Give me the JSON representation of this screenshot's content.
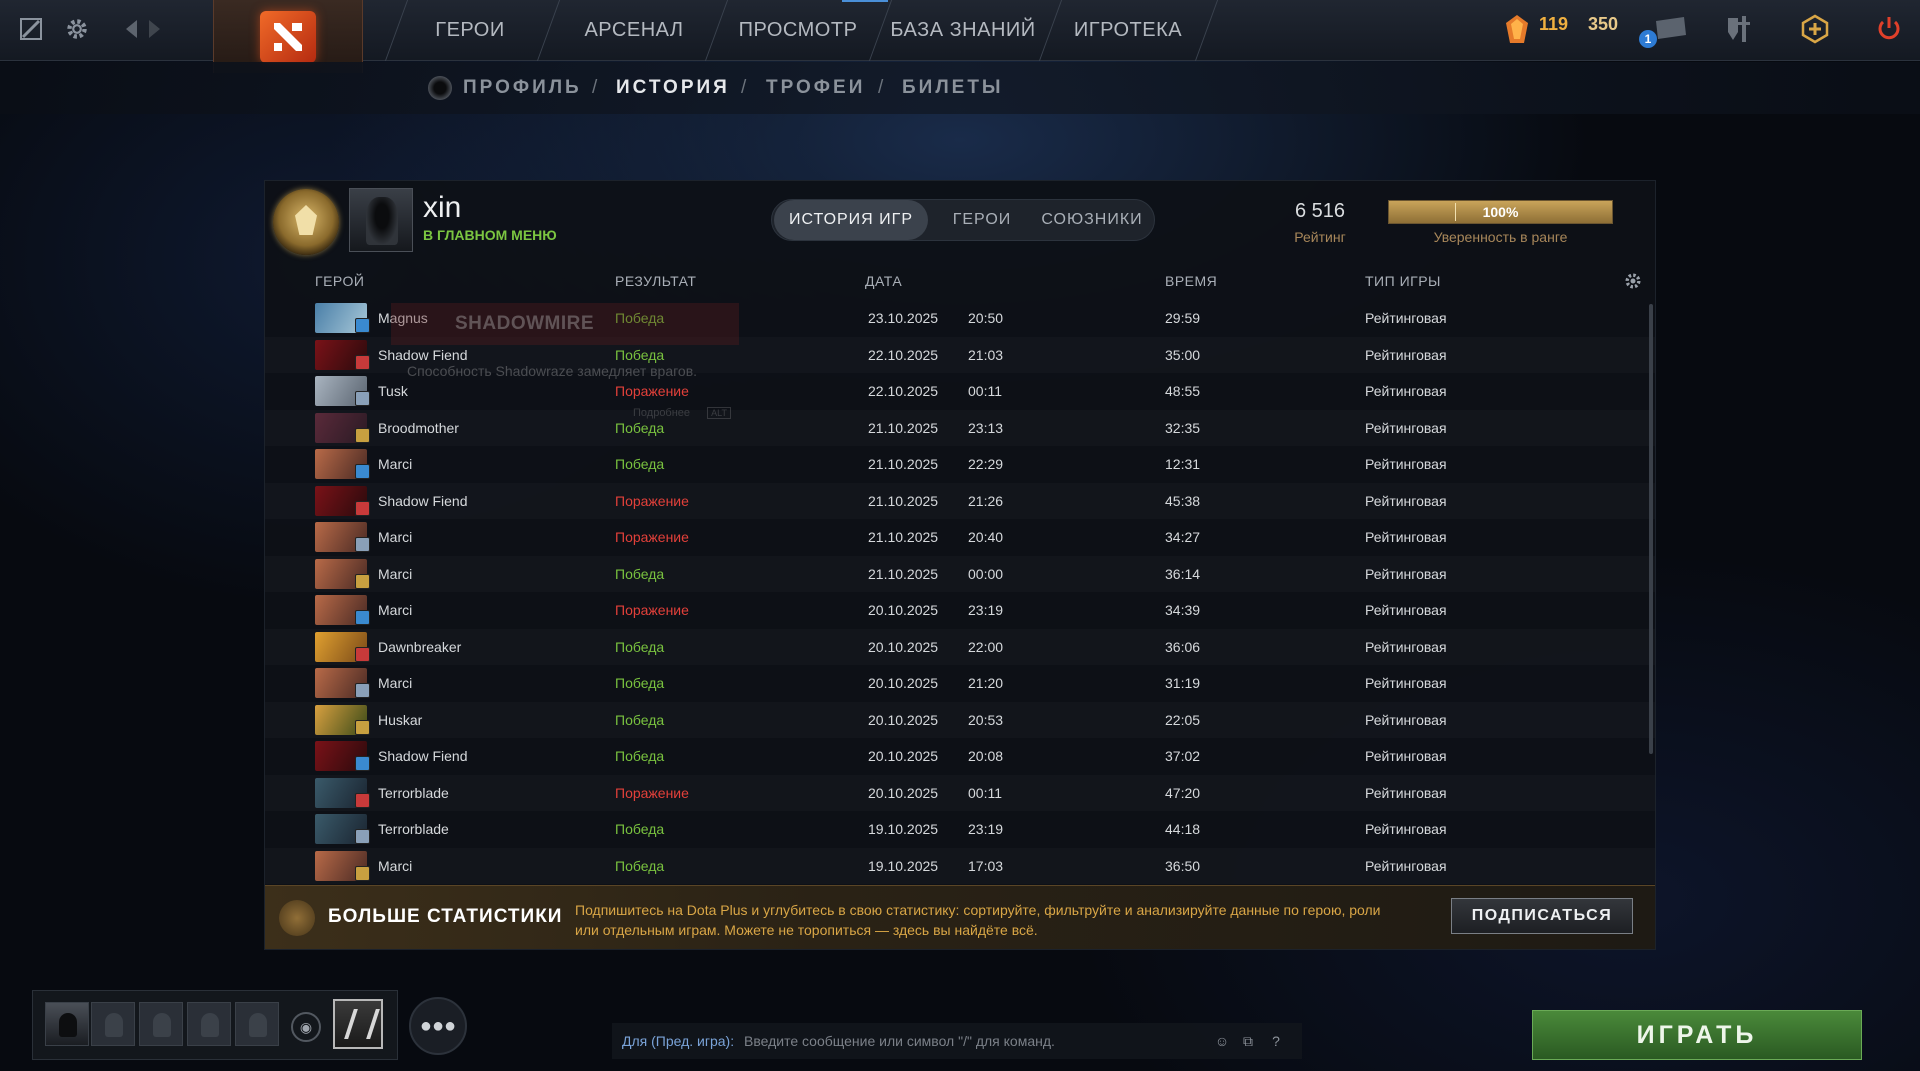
{
  "topbar": {
    "nav": [
      "ГЕРОИ",
      "АРСЕНАЛ",
      "ПРОСМОТР",
      "БАЗА ЗНАНИЙ",
      "ИГРОТЕКА"
    ],
    "shards": "119",
    "currency2": "350",
    "notifications": "1"
  },
  "subnav": {
    "profile": "ПРОФИЛЬ",
    "history": "ИСТОРИЯ",
    "trophies": "ТРОФЕИ",
    "tickets": "БИЛЕТЫ"
  },
  "profile": {
    "name": "xin",
    "status": "В ГЛАВНОМ МЕНЮ",
    "rating_value": "6 516",
    "rating_label": "Рейтинг",
    "confidence_percent": 100,
    "confidence_text": "100%",
    "confidence_label": "Уверенность в ранге"
  },
  "tabs": [
    "ИСТОРИЯ ИГР",
    "ГЕРОИ",
    "СОЮЗНИКИ"
  ],
  "table": {
    "headers": {
      "hero": "ГЕРОЙ",
      "result": "РЕЗУЛЬТАТ",
      "date": "ДАТА",
      "duration": "ВРЕМЯ",
      "mode": "ТИП ИГРЫ"
    },
    "rows": [
      {
        "hero": "Magnus",
        "result": "Победа",
        "date": "23.10.2025",
        "time": "20:50",
        "duration": "29:59",
        "mode": "Рейтинговая",
        "win": true
      },
      {
        "hero": "Shadow Fiend",
        "result": "Победа",
        "date": "22.10.2025",
        "time": "21:03",
        "duration": "35:00",
        "mode": "Рейтинговая",
        "win": true
      },
      {
        "hero": "Tusk",
        "result": "Поражение",
        "date": "22.10.2025",
        "time": "00:11",
        "duration": "48:55",
        "mode": "Рейтинговая",
        "win": false
      },
      {
        "hero": "Broodmother",
        "result": "Победа",
        "date": "21.10.2025",
        "time": "23:13",
        "duration": "32:35",
        "mode": "Рейтинговая",
        "win": true
      },
      {
        "hero": "Marci",
        "result": "Победа",
        "date": "21.10.2025",
        "time": "22:29",
        "duration": "12:31",
        "mode": "Рейтинговая",
        "win": true
      },
      {
        "hero": "Shadow Fiend",
        "result": "Поражение",
        "date": "21.10.2025",
        "time": "21:26",
        "duration": "45:38",
        "mode": "Рейтинговая",
        "win": false
      },
      {
        "hero": "Marci",
        "result": "Поражение",
        "date": "21.10.2025",
        "time": "20:40",
        "duration": "34:27",
        "mode": "Рейтинговая",
        "win": false
      },
      {
        "hero": "Marci",
        "result": "Победа",
        "date": "21.10.2025",
        "time": "00:00",
        "duration": "36:14",
        "mode": "Рейтинговая",
        "win": true
      },
      {
        "hero": "Marci",
        "result": "Поражение",
        "date": "20.10.2025",
        "time": "23:19",
        "duration": "34:39",
        "mode": "Рейтинговая",
        "win": false
      },
      {
        "hero": "Dawnbreaker",
        "result": "Победа",
        "date": "20.10.2025",
        "time": "22:00",
        "duration": "36:06",
        "mode": "Рейтинговая",
        "win": true
      },
      {
        "hero": "Marci",
        "result": "Победа",
        "date": "20.10.2025",
        "time": "21:20",
        "duration": "31:19",
        "mode": "Рейтинговая",
        "win": true
      },
      {
        "hero": "Huskar",
        "result": "Победа",
        "date": "20.10.2025",
        "time": "20:53",
        "duration": "22:05",
        "mode": "Рейтинговая",
        "win": true
      },
      {
        "hero": "Shadow Fiend",
        "result": "Победа",
        "date": "20.10.2025",
        "time": "20:08",
        "duration": "37:02",
        "mode": "Рейтинговая",
        "win": true
      },
      {
        "hero": "Terrorblade",
        "result": "Поражение",
        "date": "20.10.2025",
        "time": "00:11",
        "duration": "47:20",
        "mode": "Рейтинговая",
        "win": false
      },
      {
        "hero": "Terrorblade",
        "result": "Победа",
        "date": "19.10.2025",
        "time": "23:19",
        "duration": "44:18",
        "mode": "Рейтинговая",
        "win": true
      },
      {
        "hero": "Marci",
        "result": "Победа",
        "date": "19.10.2025",
        "time": "17:03",
        "duration": "36:50",
        "mode": "Рейтинговая",
        "win": true
      }
    ]
  },
  "tooltip": {
    "title": "SHADOWMIRE",
    "desc": "Способность Shadowraze замедляет врагов.",
    "more": "Подробнее",
    "key": "ALT"
  },
  "promo": {
    "title": "БОЛЬШЕ СТАТИСТИКИ",
    "text": "Подпишитесь на Dota Plus и углубитесь в свою статистику: сортируйте, фильтруйте и анализируйте данные по герою, роли или отдельным играм. Можете не торопиться — здесь вы найдёте всё.",
    "button": "ПОДПИСАТЬСЯ"
  },
  "chat": {
    "channel": "Для (Пред. игра):",
    "placeholder": "Введите сообщение или символ \"/\" для команд.",
    "help": "?"
  },
  "play_button": "ИГРАТЬ",
  "colors": {
    "win": "#79c23f",
    "loss": "#e2403a",
    "accent_gold": "#c9a45a",
    "play_green": "#4a8a3a"
  }
}
